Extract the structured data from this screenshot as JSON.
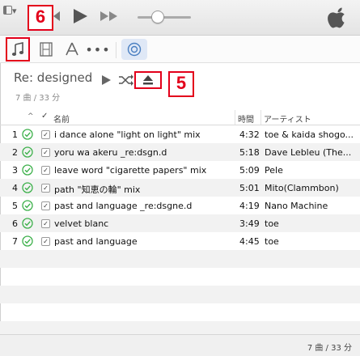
{
  "toolbar": {
    "callout_top": "6",
    "volume_level": 0.32,
    "icons": [
      "sidebar-menu-icon",
      "previous-icon",
      "play-icon",
      "next-icon",
      "volume-slider",
      "apple-logo-icon"
    ]
  },
  "media_bar": {
    "icons": [
      "music-note-icon",
      "film-icon",
      "app-store-icon",
      "more-icon",
      "device-icon"
    ],
    "more_label": "•••"
  },
  "playlist": {
    "title": "Re: designed",
    "subtitle": "7 曲 / 33 分",
    "callout_eject": "5"
  },
  "table": {
    "headers": {
      "sort": "^",
      "check": "✓",
      "name": "名前",
      "time": "時間",
      "artist": "アーティスト"
    },
    "rows": [
      {
        "num": "1",
        "name": "i dance alone \"light on light\" mix",
        "time": "4:32",
        "artist": "toe & kaida shogo..."
      },
      {
        "num": "2",
        "name": "yoru wa akeru _re:dsgn.d",
        "time": "5:18",
        "artist": "Dave Lebleu (The..."
      },
      {
        "num": "3",
        "name": "leave word \"cigarette papers\" mix",
        "time": "5:09",
        "artist": "Pele"
      },
      {
        "num": "4",
        "name": "path \"知恵の輪\" mix",
        "time": "5:01",
        "artist": "Mito(Clammbon)"
      },
      {
        "num": "5",
        "name": "past and language _re:dsgne.d",
        "time": "4:19",
        "artist": "Nano Machine"
      },
      {
        "num": "6",
        "name": "velvet blanc",
        "time": "3:49",
        "artist": "toe"
      },
      {
        "num": "7",
        "name": "past and language",
        "time": "4:45",
        "artist": "toe"
      }
    ]
  },
  "status": {
    "text": "7 曲 / 33 分"
  },
  "colors": {
    "accent_red": "#e3001b",
    "check_green": "#3cb04a",
    "device_highlight": "#dfe8f6"
  }
}
